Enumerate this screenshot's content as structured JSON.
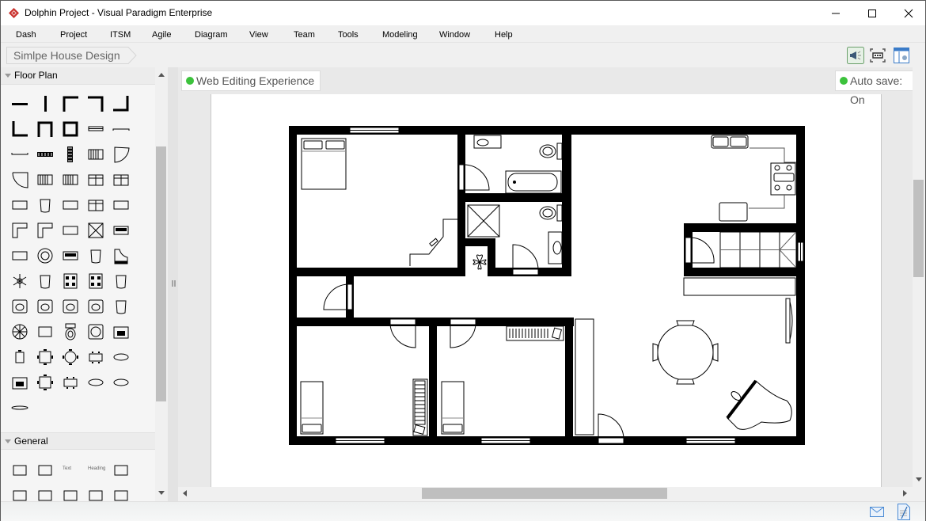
{
  "window": {
    "title": "Dolphin Project - Visual Paradigm Enterprise",
    "controls": [
      "minimize",
      "maximize",
      "close"
    ]
  },
  "menu": {
    "items": [
      "Dash",
      "Project",
      "ITSM",
      "Agile",
      "Diagram",
      "View",
      "Team",
      "Tools",
      "Modeling",
      "Window",
      "Help"
    ]
  },
  "breadcrumb": {
    "items": [
      "Simlpe House Design"
    ]
  },
  "toolbar": {
    "icons": [
      "announcement-icon",
      "fit-diagram-icon",
      "layout-panel-icon"
    ]
  },
  "palette": {
    "sections": [
      {
        "label": "Floor Plan",
        "expanded": true,
        "shapes": [
          "wall-horizontal",
          "wall-vertical",
          "wall-corner-top-left",
          "wall-corner-top-right",
          "wall-corner-bottom-right",
          "wall-corner-bottom-left",
          "wall-u-shape",
          "wall-room",
          "window",
          "door-opening",
          "door-opening-2",
          "radiator-horizontal",
          "radiator-vertical",
          "radiator-grill",
          "door-swing-right",
          "door-swing-left",
          "double-door",
          "bathtub",
          "bed-small",
          "wardrobe",
          "stereo",
          "stool",
          "tv-set",
          "sofa",
          "lamp-table",
          "corner-desk",
          "l-desk",
          "desk",
          "shower",
          "fax",
          "counter",
          "round-dial",
          "oven",
          "chair-pot",
          "grand-piano",
          "plant",
          "armchair",
          "stove-4",
          "stove-cooktop",
          "armchair-2",
          "corner-sink",
          "round-sink",
          "sink",
          "double-sink",
          "sofa-single",
          "ceiling-fan",
          "table-rect",
          "toilet",
          "washing-machine",
          "printer",
          "table-1-chair",
          "table-4-chairs",
          "round-table-4",
          "table-6",
          "oval-table-6",
          "computer-desk",
          "table-4-square",
          "table-6-rect",
          "oval-table-8",
          "oval-table-10",
          "oval-long-table"
        ]
      },
      {
        "label": "General",
        "expanded": true,
        "shapes": [
          "rectangle",
          "rounded-rectangle",
          "text",
          "heading",
          "thick-rectangle",
          "rounded-thick",
          "ellipse",
          "ellipse-thick",
          "square",
          "square-thick"
        ],
        "shape_labels": {
          "text": "Text",
          "heading": "Heading"
        }
      }
    ]
  },
  "canvas": {
    "left_status": {
      "label": "Web Editing Experience",
      "color": "#3cc23c"
    },
    "right_status": {
      "label": "Auto save: On",
      "color": "#3cc23c"
    }
  },
  "diagram": {
    "name": "Simlpe House Design",
    "type": "floor-plan",
    "rooms": [
      "master-bedroom",
      "bathroom-1",
      "bathroom-2",
      "kitchen",
      "stairs",
      "hallway",
      "closet",
      "bedroom-2",
      "bedroom-3",
      "living-dining-room"
    ],
    "furniture": [
      "double-bed",
      "sink",
      "toilet",
      "bathtub",
      "shower",
      "toilet",
      "sink",
      "plant",
      "corner-desk",
      "double-sink",
      "stove",
      "counter",
      "sofa",
      "round-table-4-chairs",
      "grand-piano",
      "tv",
      "single-bed",
      "single-bed",
      "radiator",
      "radiator",
      "bookshelf"
    ]
  },
  "statusbar": {
    "icons": [
      "mail-icon",
      "document-edit-icon"
    ]
  }
}
